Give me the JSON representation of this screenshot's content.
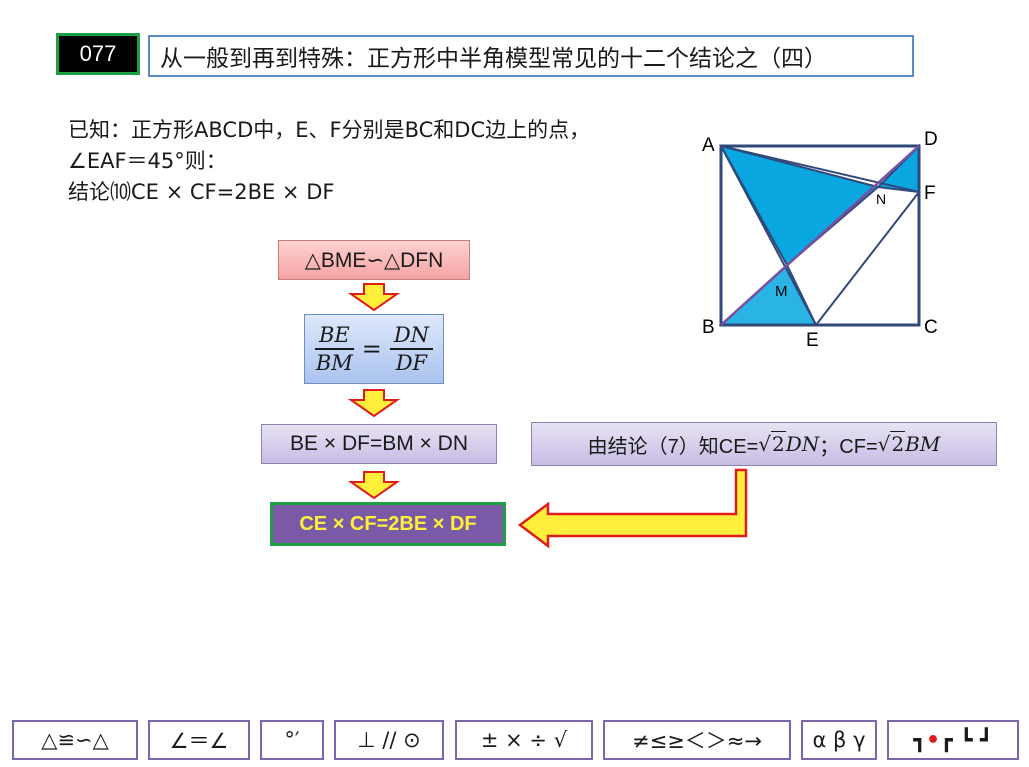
{
  "header": {
    "number": "077",
    "title": "从一般到再到特殊：正方形中半角模型常见的十二个结论之（四）"
  },
  "given": {
    "line1": "已知：正方形ABCD中，E、F分别是BC和DC边上的点，",
    "line2": "∠EAF＝45°则：",
    "line3": "结论⑽CE × CF=2BE × DF"
  },
  "flow": {
    "similar": "△BME∽△DFN",
    "ratio": {
      "left_num": "BE",
      "left_den": "BM",
      "equals": "=",
      "right_num": "DN",
      "right_den": "DF"
    },
    "product": "BE × DF=BM × DN",
    "reference": {
      "prefix": "由结论（7）知CE=",
      "sqrt1": "2",
      "var1": "DN",
      "sep": "；CF=",
      "sqrt2": "2",
      "var2": "BM"
    },
    "result": "CE × CF=2BE × DF"
  },
  "diagram": {
    "labels": {
      "A": "A",
      "B": "B",
      "C": "C",
      "D": "D",
      "E": "E",
      "F": "F",
      "M": "M",
      "N": "N"
    },
    "colors": {
      "fill_large": "#0aa6e0",
      "fill_small": "#2ab4e6",
      "diagonal": "#7a4fa0",
      "outline": "#2f4a7a"
    }
  },
  "toolbar": [
    {
      "name": "congruence-symbols",
      "label": "△≌∽△"
    },
    {
      "name": "angle-symbols",
      "label": "∠＝∠"
    },
    {
      "name": "degree-symbols",
      "label": "°′"
    },
    {
      "name": "geometry-symbols",
      "label": "⊥ // ⊙"
    },
    {
      "name": "operator-symbols",
      "label": "± × ÷ √"
    },
    {
      "name": "comparison-symbols",
      "label": "≠≤≥＜＞≈→"
    },
    {
      "name": "greek-symbols",
      "label": "α β γ"
    },
    {
      "name": "corner-symbols",
      "left": "┓",
      "dot": "•",
      "right": "┏ ┗ ┛"
    }
  ],
  "arrow_colors": {
    "fill": "#ffef3a",
    "stroke": "#e01d1d"
  }
}
